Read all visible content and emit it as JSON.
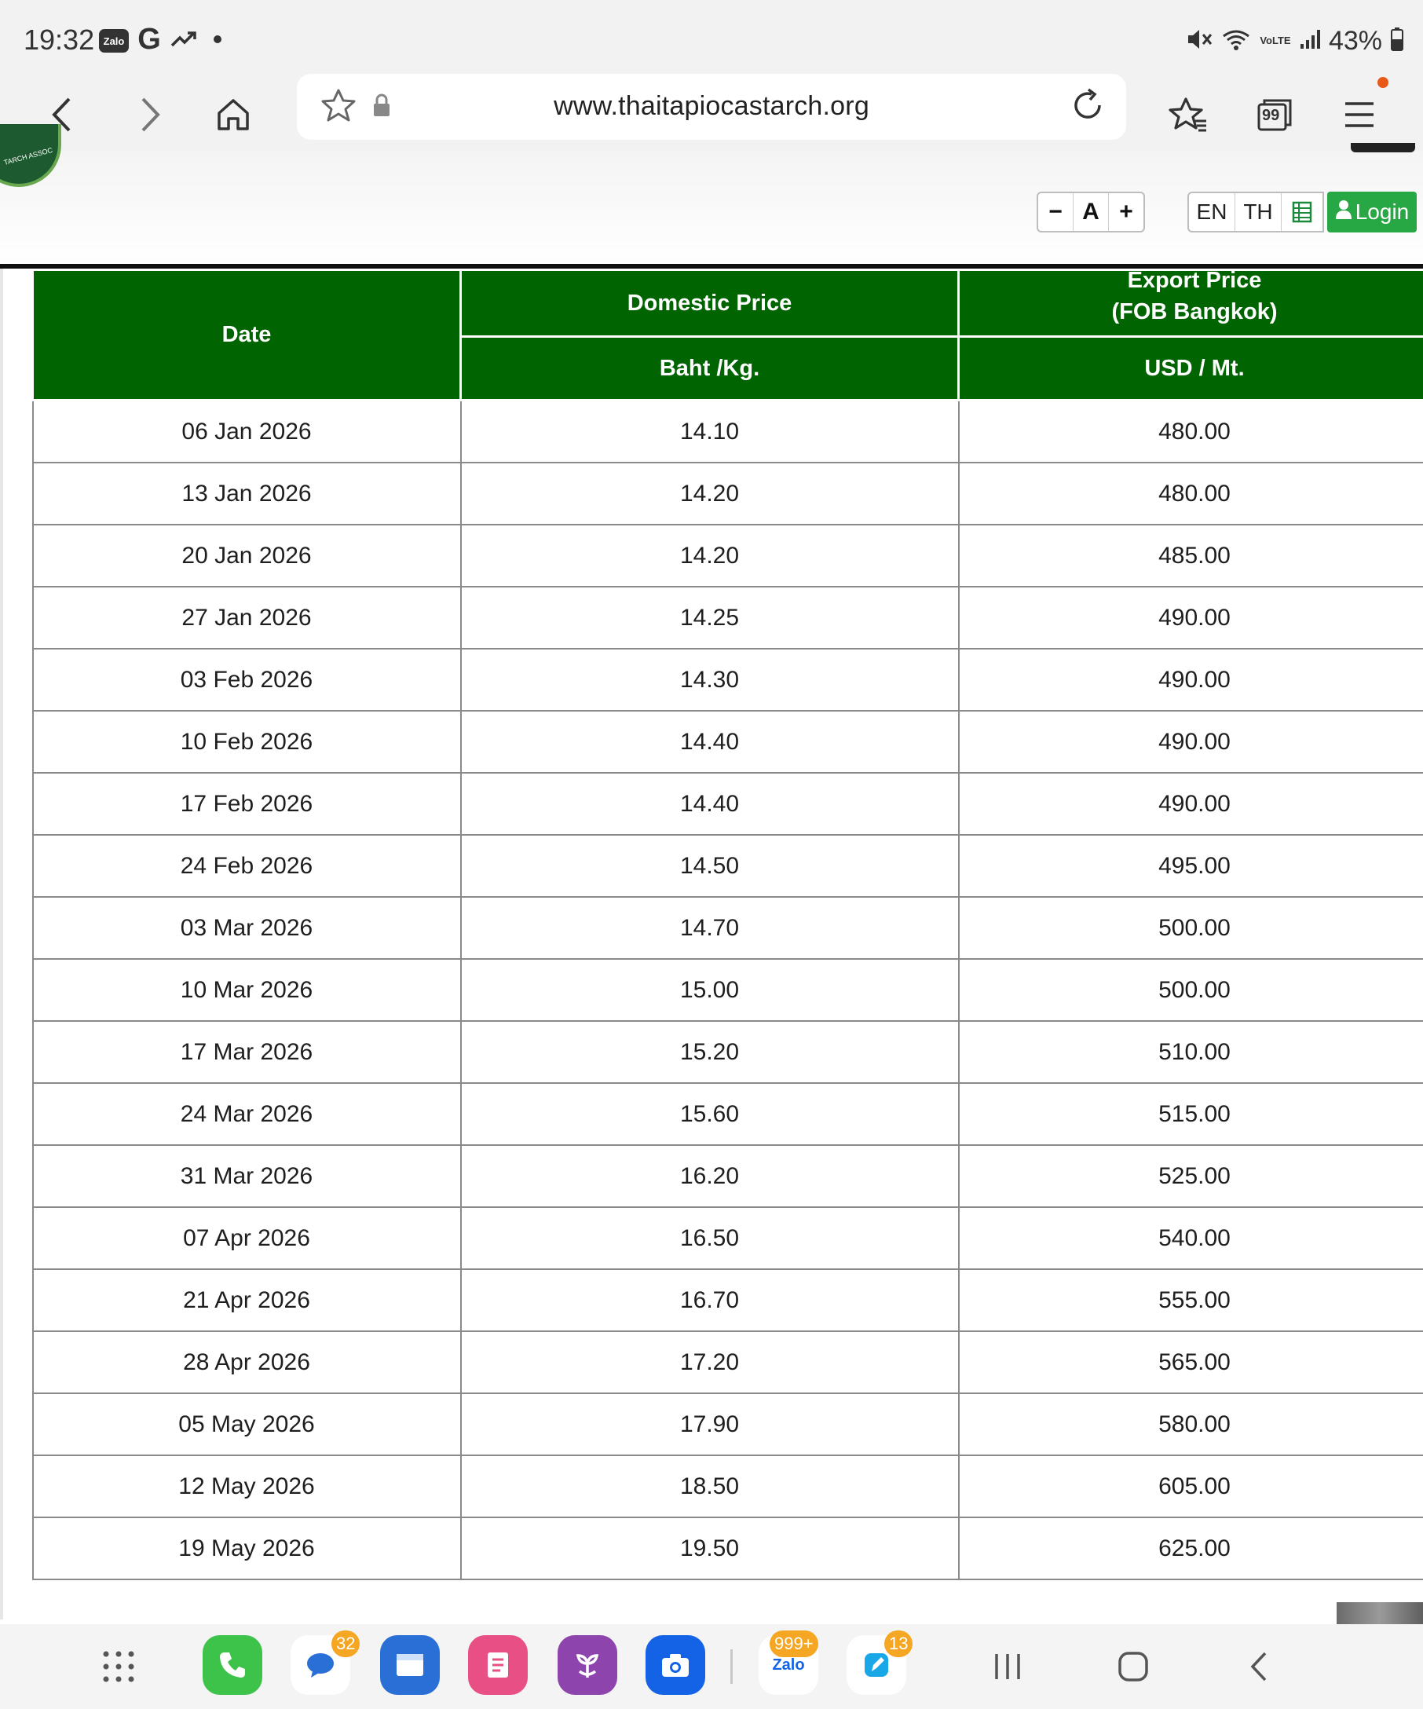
{
  "status_bar": {
    "time": "19:32",
    "notification_icons": [
      "zalo-icon",
      "google-icon",
      "trending-icon",
      "dot-icon"
    ],
    "zalo_label": "Zalo",
    "g_label": "G",
    "signal_icons": [
      "mute-icon",
      "wifi-icon",
      "volte-icon",
      "signal-icon"
    ],
    "volte_label": "VoLTE",
    "battery": "43%"
  },
  "browser": {
    "url": "www.thaitapiocastarch.org",
    "tab_count": "99"
  },
  "site_header": {
    "font_decrease": "−",
    "font_reset": "A",
    "font_increase": "+",
    "lang_en": "EN",
    "lang_th": "TH",
    "login_label": "Login"
  },
  "table": {
    "headers": {
      "date": "Date",
      "domestic": "Domestic Price",
      "export_line1": "Export Price",
      "export_line2": "(FOB Bangkok)",
      "domestic_unit": "Baht /Kg.",
      "export_unit": "USD / Mt."
    },
    "rows": [
      {
        "date": "06 Jan 2026",
        "domestic": "14.10",
        "export": "480.00"
      },
      {
        "date": "13 Jan 2026",
        "domestic": "14.20",
        "export": "480.00"
      },
      {
        "date": "20 Jan 2026",
        "domestic": "14.20",
        "export": "485.00"
      },
      {
        "date": "27 Jan 2026",
        "domestic": "14.25",
        "export": "490.00"
      },
      {
        "date": "03 Feb 2026",
        "domestic": "14.30",
        "export": "490.00"
      },
      {
        "date": "10 Feb 2026",
        "domestic": "14.40",
        "export": "490.00"
      },
      {
        "date": "17 Feb 2026",
        "domestic": "14.40",
        "export": "490.00"
      },
      {
        "date": "24 Feb 2026",
        "domestic": "14.50",
        "export": "495.00"
      },
      {
        "date": "03 Mar 2026",
        "domestic": "14.70",
        "export": "500.00"
      },
      {
        "date": "10 Mar 2026",
        "domestic": "15.00",
        "export": "500.00"
      },
      {
        "date": "17 Mar 2026",
        "domestic": "15.20",
        "export": "510.00"
      },
      {
        "date": "24 Mar 2026",
        "domestic": "15.60",
        "export": "515.00"
      },
      {
        "date": "31 Mar 2026",
        "domestic": "16.20",
        "export": "525.00"
      },
      {
        "date": "07 Apr 2026",
        "domestic": "16.50",
        "export": "540.00"
      },
      {
        "date": "21 Apr 2026",
        "domestic": "16.70",
        "export": "555.00"
      },
      {
        "date": "28 Apr 2026",
        "domestic": "17.20",
        "export": "565.00"
      },
      {
        "date": "05 May 2026",
        "domestic": "17.90",
        "export": "580.00"
      },
      {
        "date": "12 May 2026",
        "domestic": "18.50",
        "export": "605.00"
      },
      {
        "date": "19 May 2026",
        "domestic": "19.50",
        "export": "625.00"
      }
    ]
  },
  "dock": {
    "apps": [
      {
        "name": "phone",
        "color": "#3dc24a",
        "badge": ""
      },
      {
        "name": "messages",
        "color": "#ffffff",
        "badge": "32"
      },
      {
        "name": "browser",
        "color": "#2a6fd6",
        "badge": ""
      },
      {
        "name": "notes",
        "color": "#e84f84",
        "badge": ""
      },
      {
        "name": "bixby",
        "color": "#8e44ad",
        "badge": ""
      },
      {
        "name": "camera",
        "color": "#1463e6",
        "badge": ""
      },
      {
        "name": "zalo",
        "color": "#ffffff",
        "badge": "999+"
      },
      {
        "name": "edit",
        "color": "#ffffff",
        "badge": "13"
      }
    ],
    "zalo_label": "Zalo"
  }
}
